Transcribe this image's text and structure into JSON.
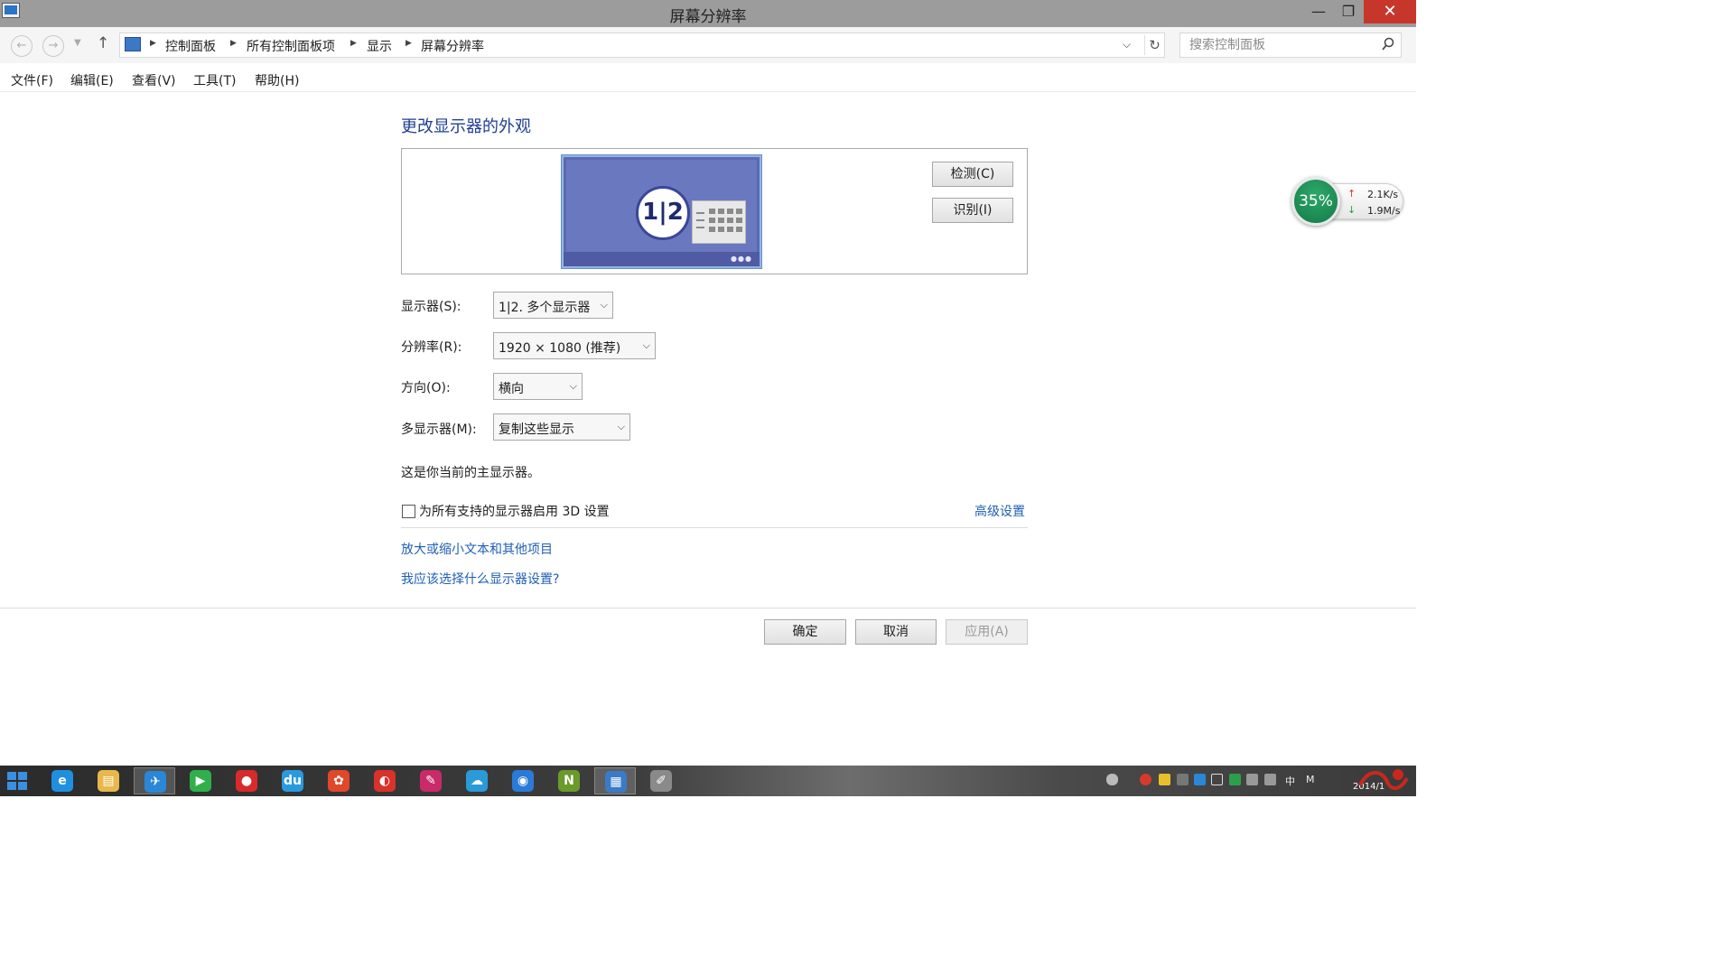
{
  "window": {
    "title": "屏幕分辨率",
    "controls": {
      "minimize": "—",
      "maximize": "❐",
      "close": "✕"
    }
  },
  "navigation": {
    "breadcrumbs": [
      "控制面板",
      "所有控制面板项",
      "显示",
      "屏幕分辨率"
    ],
    "search_placeholder": "搜索控制面板"
  },
  "menu": [
    "文件(F)",
    "编辑(E)",
    "查看(V)",
    "工具(T)",
    "帮助(H)"
  ],
  "main": {
    "heading": "更改显示器的外观",
    "monitor_badge": "1|2",
    "detect_button": "检测(C)",
    "identify_button": "识别(I)",
    "fields": {
      "display": {
        "label": "显示器(S):",
        "value": "1|2. 多个显示器"
      },
      "resolution": {
        "label": "分辨率(R):",
        "value": "1920 × 1080 (推荐)"
      },
      "orientation": {
        "label": "方向(O):",
        "value": "横向"
      },
      "multiple": {
        "label": "多显示器(M):",
        "value": "复制这些显示"
      }
    },
    "primary_note": "这是你当前的主显示器。",
    "enable_3d_label": "为所有支持的显示器启用 3D 设置",
    "enable_3d_checked": false,
    "advanced_link": "高级设置",
    "links": [
      "放大或缩小文本和其他项目",
      "我应该选择什么显示器设置?"
    ],
    "buttons": {
      "ok": "确定",
      "cancel": "取消",
      "apply": "应用(A)"
    }
  },
  "net_widget": {
    "percent": "35%",
    "upload": "2.1K/s",
    "download": "1.9M/s"
  },
  "taskbar": {
    "apps": [
      {
        "name": "internet-explorer",
        "glyph": "e",
        "color": "#1f8fe0"
      },
      {
        "name": "file-explorer",
        "glyph": "▤",
        "color": "#e8b84a"
      },
      {
        "name": "mail-app",
        "glyph": "✈",
        "color": "#2a87d8"
      },
      {
        "name": "media-player",
        "glyph": "▶",
        "color": "#2fb04a"
      },
      {
        "name": "music-player",
        "glyph": "●",
        "color": "#d82a2a"
      },
      {
        "name": "baidu-cloud",
        "glyph": "du",
        "color": "#2a9ae0"
      },
      {
        "name": "flower-app",
        "glyph": "✿",
        "color": "#e0482a"
      },
      {
        "name": "swirl-app",
        "glyph": "◐",
        "color": "#d8322a"
      },
      {
        "name": "pen-app",
        "glyph": "✎",
        "color": "#c82a6a"
      },
      {
        "name": "cloud-app",
        "glyph": "☁",
        "color": "#2a9ad8"
      },
      {
        "name": "chat-app",
        "glyph": "◉",
        "color": "#2a7ad8"
      },
      {
        "name": "nvidia-app",
        "glyph": "N",
        "color": "#6a9a2a"
      },
      {
        "name": "control-panel",
        "glyph": "▦",
        "color": "#3a7ac8"
      },
      {
        "name": "paint-app",
        "glyph": "✐",
        "color": "#8a8a8a"
      }
    ],
    "tray_ime": "中",
    "tray_m": "M",
    "clock_date": "2014/1"
  }
}
